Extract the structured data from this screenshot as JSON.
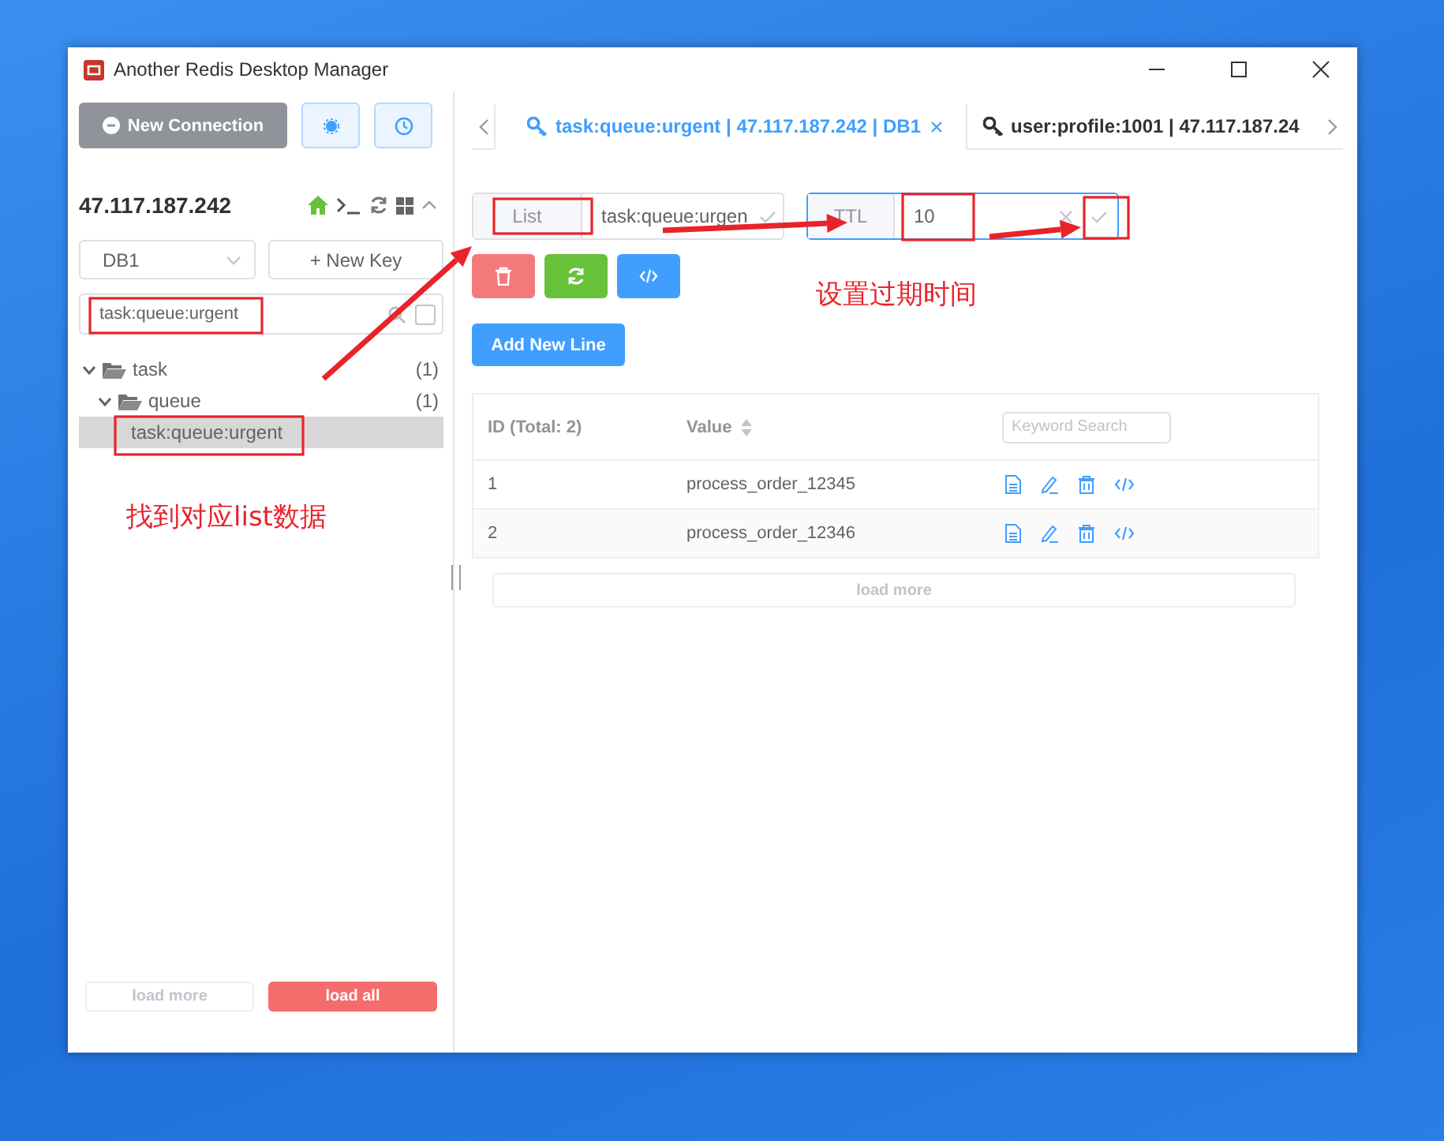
{
  "window": {
    "title": "Another Redis Desktop Manager"
  },
  "sidebar": {
    "new_connection": "New Connection",
    "server": "47.117.187.242",
    "db_select": "DB1",
    "new_key": "+ New Key",
    "search": {
      "value": "task:queue:urgent",
      "exact_match": false
    },
    "tree": [
      {
        "label": "task",
        "count": "(1)",
        "expanded": true,
        "selected": false,
        "children": [
          {
            "label": "queue",
            "count": "(1)",
            "expanded": true,
            "selected": false,
            "children": [
              {
                "label": "task:queue:urgent",
                "selected": true
              }
            ]
          }
        ]
      }
    ],
    "load_more": {
      "label": "load more",
      "disabled": true
    },
    "load_all": {
      "label": "load all"
    }
  },
  "tabs": [
    {
      "label": "task:queue:urgent | 47.117.187.242 | DB1",
      "selected": true,
      "closable": true
    },
    {
      "label": "user:profile:1001 | 47.117.187.24",
      "selected": false,
      "closable": false
    }
  ],
  "key_bar": {
    "type": "List",
    "name": "task:queue:urgen",
    "ttl_label": "TTL",
    "ttl": "10",
    "ttl_focused": true
  },
  "add_button": "Add New Line",
  "table": {
    "columns": [
      "ID (Total: 2)",
      "Value"
    ],
    "search_placeholder": "Keyword Search",
    "rows": [
      {
        "id": "1",
        "value": "process_order_12345"
      },
      {
        "id": "2",
        "value": "process_order_12346"
      }
    ],
    "load_more": {
      "label": "load more",
      "disabled": true
    }
  },
  "annotations": [
    {
      "text": "找到对应list数据"
    },
    {
      "text": "设置过期时间"
    }
  ]
}
